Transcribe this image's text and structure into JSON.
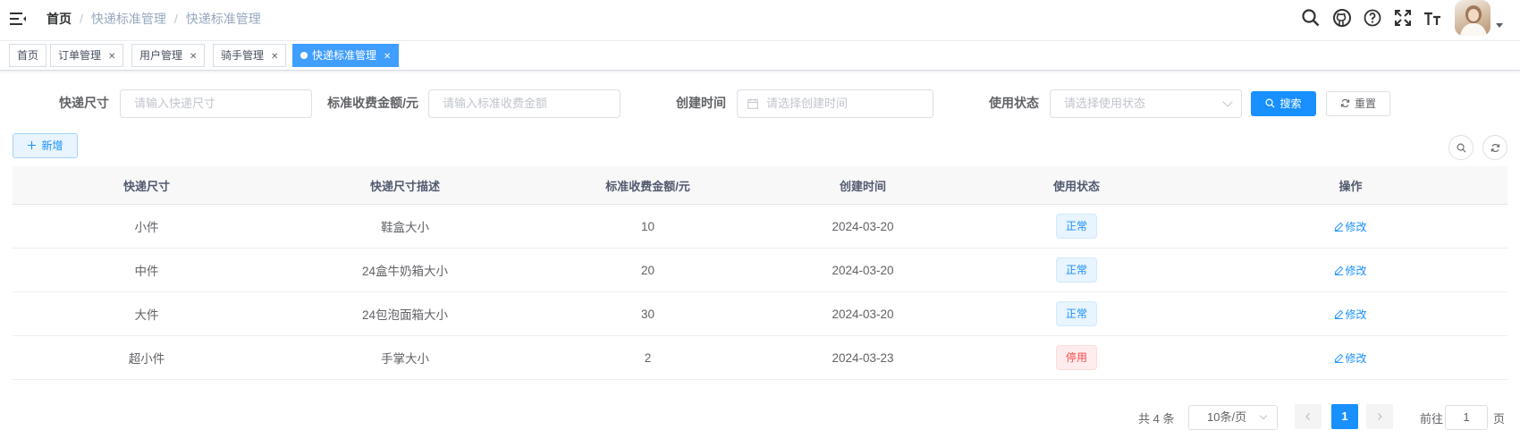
{
  "navbar": {
    "breadcrumb": [
      "首页",
      "快递标准管理",
      "快递标准管理"
    ],
    "icons": [
      "search-icon",
      "github-icon",
      "help-icon",
      "fullscreen-icon",
      "font-size-icon"
    ]
  },
  "tags": [
    {
      "label": "首页",
      "closable": false
    },
    {
      "label": "订单管理",
      "closable": true
    },
    {
      "label": "用户管理",
      "closable": true
    },
    {
      "label": "骑手管理",
      "closable": true
    },
    {
      "label": "快递标准管理",
      "closable": true,
      "active": true
    }
  ],
  "form": {
    "size": {
      "label": "快递尺寸",
      "placeholder": "请输入快递尺寸"
    },
    "fee": {
      "label": "标准收费金额/元",
      "placeholder": "请输入标准收费金额"
    },
    "time": {
      "label": "创建时间",
      "placeholder": "请选择创建时间"
    },
    "status": {
      "label": "使用状态",
      "placeholder": "请选择使用状态"
    },
    "search_label": "搜索",
    "reset_label": "重置"
  },
  "toolbar": {
    "add_label": "新增"
  },
  "table": {
    "headers": [
      "快递尺寸",
      "快递尺寸描述",
      "标准收费金额/元",
      "创建时间",
      "使用状态",
      "操作"
    ],
    "rows": [
      {
        "size": "小件",
        "desc": "鞋盒大小",
        "fee": "10",
        "time": "2024-03-20",
        "status": "正常",
        "action": "修改"
      },
      {
        "size": "中件",
        "desc": "24盒牛奶箱大小",
        "fee": "20",
        "time": "2024-03-20",
        "status": "正常",
        "action": "修改"
      },
      {
        "size": "大件",
        "desc": "24包泡面箱大小",
        "fee": "30",
        "time": "2024-03-20",
        "status": "正常",
        "action": "修改"
      },
      {
        "size": "超小件",
        "desc": "手掌大小",
        "fee": "2",
        "time": "2024-03-23",
        "status": "停用",
        "action": "修改"
      }
    ]
  },
  "pagination": {
    "total": "共 4 条",
    "page_size": "10条/页",
    "current": "1",
    "jump_label": "前往",
    "jump_value": "1",
    "jump_unit": "页"
  },
  "colors": {
    "primary": "#1890ff",
    "tag_active": "#409eff",
    "status_ok": "#1890ff",
    "status_off": "#ff4949"
  }
}
